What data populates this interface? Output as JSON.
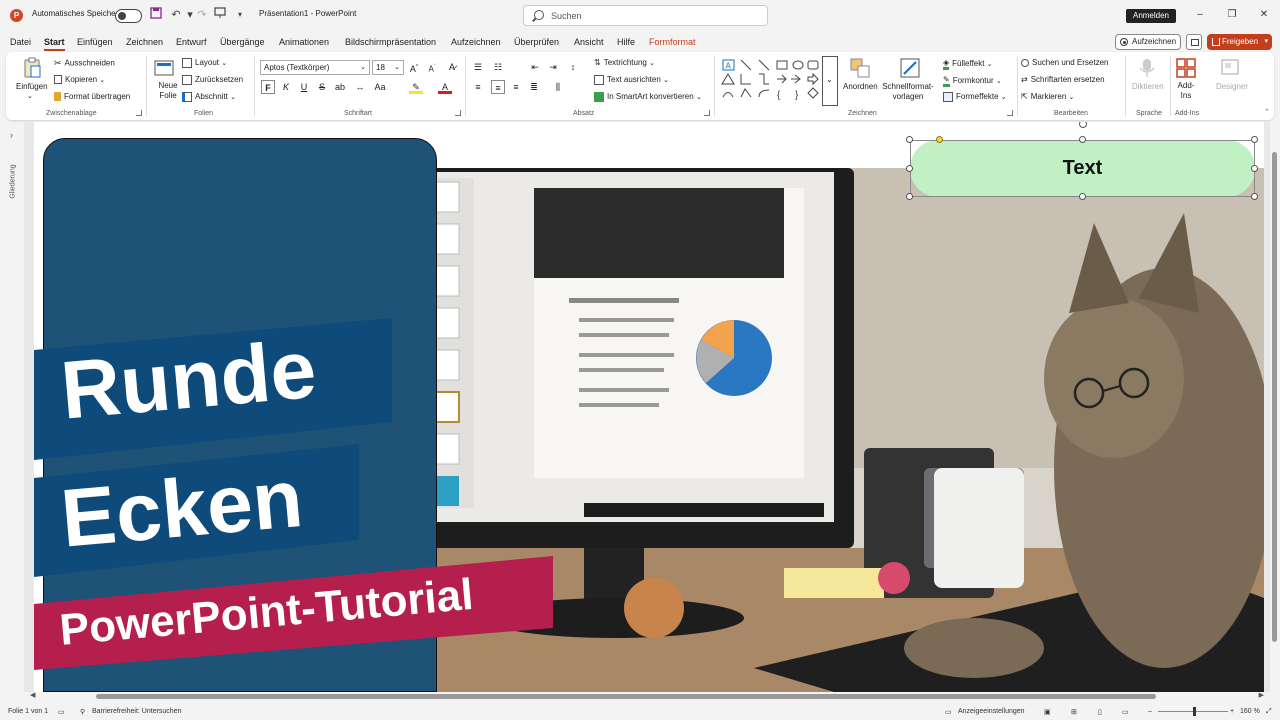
{
  "app": {
    "autosave_label": "Automatisches Speichern",
    "window_title": "Präsentation1  -  PowerPoint",
    "search_placeholder": "Suchen",
    "signin_label": "Anmelden",
    "logo_letter": "P"
  },
  "menu": {
    "tabs": [
      "Datei",
      "Start",
      "Einfügen",
      "Zeichnen",
      "Entwurf",
      "Übergänge",
      "Animationen",
      "Bildschirmpräsentation",
      "Aufzeichnen",
      "Überprüfen",
      "Ansicht",
      "Hilfe",
      "Formformat"
    ],
    "active_tab": "Start",
    "record_label": "Aufzeichnen",
    "share_label": "Freigeben"
  },
  "ribbon": {
    "clipboard": {
      "paste_label": "Einfügen",
      "cut_label": "Ausschneiden",
      "copy_label": "Kopieren",
      "format_painter_label": "Format übertragen",
      "group_label": "Zwischenablage"
    },
    "slides": {
      "new_slide_label": "Neue Folie",
      "layout_label": "Layout",
      "reset_label": "Zurücksetzen",
      "section_label": "Abschnitt",
      "group_label": "Folien"
    },
    "font": {
      "font_name": "Aptos (Textkörper)",
      "font_size": "18",
      "bold": "F",
      "italic": "K",
      "underline": "U",
      "strike": "S",
      "group_label": "Schriftart"
    },
    "paragraph": {
      "text_direction_label": "Textrichtung",
      "align_text_label": "Text ausrichten",
      "smartart_label": "In SmartArt konvertieren",
      "group_label": "Absatz"
    },
    "drawing": {
      "arrange_label": "Anordnen",
      "quick_styles_label": "Schnellformat-vorlagen",
      "fill_label": "Fülleffekt",
      "outline_label": "Formkontur",
      "effects_label": "Formeffekte",
      "group_label": "Zeichnen"
    },
    "editing": {
      "find_label": "Suchen und Ersetzen",
      "replace_fonts_label": "Schriftarten ersetzen",
      "select_label": "Markieren",
      "group_label": "Bearbeiten"
    },
    "voice": {
      "dictate_label": "Diktieren",
      "group_label": "Sprache"
    },
    "addins": {
      "addins_label": "Add-Ins",
      "designer_label": "Designer",
      "group_label": "Add-Ins"
    }
  },
  "left_panel": {
    "label": "Gliederung"
  },
  "slide": {
    "headline_line1": "Runde",
    "headline_line2": "Ecken",
    "subtitle": "PowerPoint-Tutorial",
    "shape_text": "Text"
  },
  "colors": {
    "accent": "#c43e1c",
    "headline_band": "#0e4a7a",
    "subtitle_band": "#b51f4e",
    "teal_block": "#1f5277",
    "shape_fill": "#c1f0c4"
  },
  "status": {
    "slide_info": "Folie 1 von 1",
    "accessibility": "Barrierefreiheit: Untersuchen",
    "display_settings": "Anzeigeeinstellungen",
    "zoom": "160 %"
  }
}
